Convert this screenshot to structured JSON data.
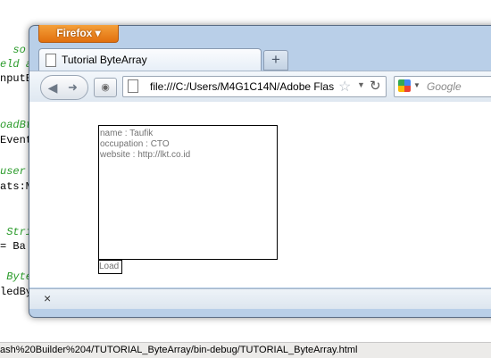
{
  "background": {
    "code_lines": [
      {
        "text": "  so",
        "comment": true
      },
      {
        "text": "eld a",
        "comment": true
      },
      {
        "text": "nputB",
        "comment": false
      },
      {
        "text": "oadBt",
        "comment": true
      },
      {
        "text": "Event",
        "comment": false
      },
      {
        "text": "user",
        "comment": true
      },
      {
        "text": "ats:M",
        "comment": false
      },
      {
        "text": " Stri",
        "comment": true
      },
      {
        "text": "= Ba",
        "comment": false
      },
      {
        "text": " Byte",
        "comment": true
      },
      {
        "text": "ledBy",
        "comment": false
      }
    ],
    "status_path": "ash%20Builder%204/TUTORIAL_ByteArray/bin-debug/TUTORIAL_ByteArray.html"
  },
  "browser": {
    "app_button": "Firefox ▾",
    "tab_title": "Tutorial ByteArray",
    "new_tab": "+",
    "url": "file:///C:/Users/M4G1C14N/Adobe Flas",
    "search_placeholder": "Google",
    "close_symbol": "×"
  },
  "page": {
    "textarea_lines": [
      "name : Taufik",
      "occupation : CTO",
      "website : http://lkt.co.id"
    ],
    "load_button": "Load"
  }
}
